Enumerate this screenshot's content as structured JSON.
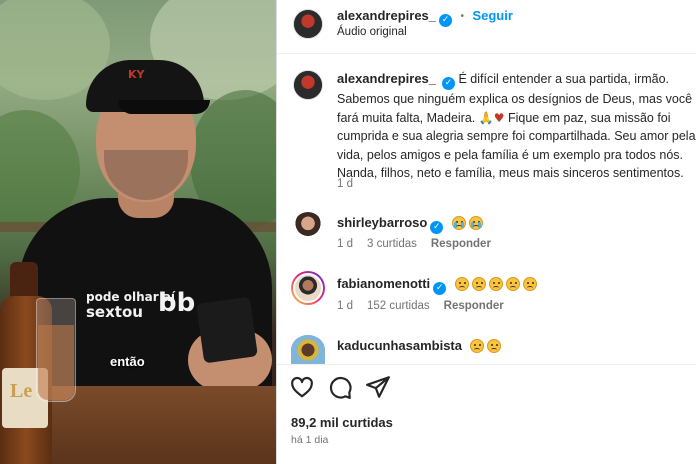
{
  "media": {
    "caption": "então",
    "shirt_line1": "pode olhar aí",
    "shirt_line2": "sextou",
    "shirt_bb": "bb",
    "cap_logo": "KY",
    "bottle_label": "Le"
  },
  "header": {
    "username": "alexandrepires_",
    "follow_label": "Seguir",
    "separator": "•",
    "audio": "Áudio original"
  },
  "caption_post": {
    "username": "alexandrepires_",
    "lines": [
      "É difícil entender a sua partida, irmão.",
      "Sabemos que ninguém explica os desígnios de Deus, mas você",
      "fará muita falta, Madeira.",
      "Fique em paz, sua missão foi",
      "cumprida e sua alegria sempre foi compartilhada. Seu amor pela",
      "vida, pelos amigos e pela família é um exemplo pra todos nós.",
      "Nanda, filhos, neto e família, meus mais sinceros sentimentos."
    ],
    "time": "1 d"
  },
  "comments": [
    {
      "username": "shirleybarroso",
      "time": "1 d",
      "likes": "3 curtidas",
      "reply": "Responder",
      "emoji_count": 2,
      "emoji_type": "cry"
    },
    {
      "username": "fabianomenotti",
      "time": "1 d",
      "likes": "152 curtidas",
      "reply": "Responder",
      "emoji_count": 5,
      "emoji_type": "sad"
    },
    {
      "username": "kaducunhasambista",
      "emoji_count": 2,
      "emoji_type": "sad"
    }
  ],
  "footer": {
    "likes": "89,2 mil curtidas",
    "time": "há 1 dia"
  },
  "colors": {
    "accent": "#0095f6",
    "text": "#262626",
    "muted": "#737373",
    "heart": "#e0245e"
  }
}
